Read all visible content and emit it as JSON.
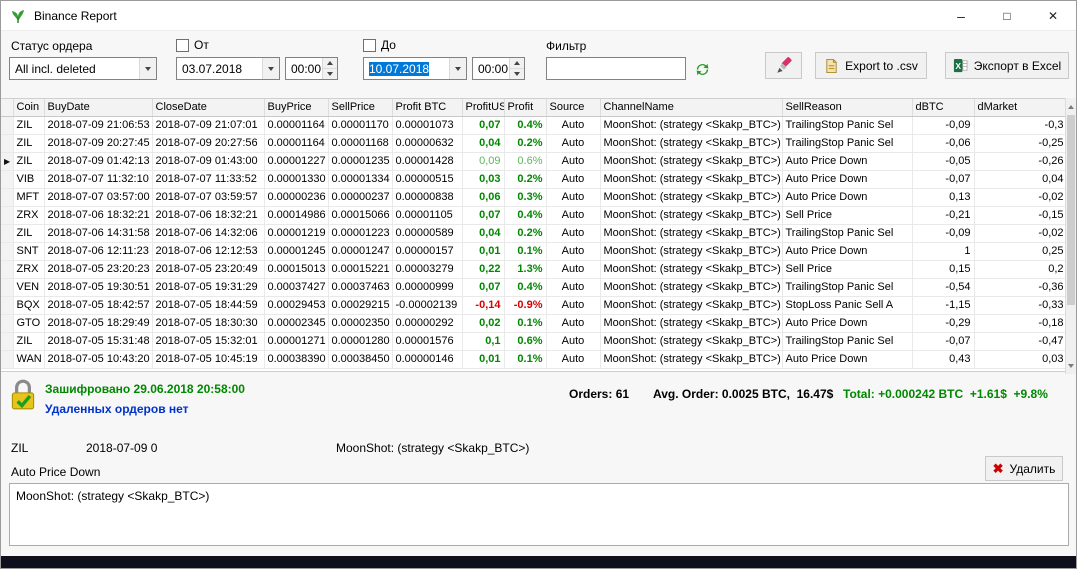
{
  "icons": {
    "row_marker": "▶",
    "delete_x": "✖"
  },
  "window": {
    "title": "Binance Report",
    "minimize": "–",
    "maximize": "□",
    "close": "✕"
  },
  "toolbar": {
    "order_status_label": "Статус ордера",
    "order_status_value": "All incl. deleted",
    "from_checkbox_label": "От",
    "from_date": "03.07.2018",
    "from_time": "00:00",
    "to_checkbox_label": "До",
    "to_date": "10.07.2018",
    "to_time": "00:00",
    "filter_label": "Фильтр",
    "filter_value": "",
    "export_csv_label": "Export to .csv",
    "export_excel_label": "Экспорт в Excel"
  },
  "grid": {
    "columns": [
      "Coin",
      "BuyDate",
      "CloseDate",
      "BuyPrice",
      "SellPrice",
      "Profit BTC",
      "ProfitUSD",
      "Profit",
      "Source",
      "ChannelName",
      "SellReason",
      "dBTC",
      "dMarket"
    ],
    "rows": [
      {
        "coin": "ZIL",
        "buy_date": "2018-07-09 21:06:53",
        "close_date": "2018-07-09 21:07:01",
        "buy_price": "0.00001164",
        "sell_price": "0.00001170",
        "profit_btc": "0.00001073",
        "profit_usd": "0,07",
        "profit_pct": "0.4%",
        "source": "Auto",
        "channel": "MoonShot: (strategy <Skakp_BTC>)",
        "sell_reason": "TrailingStop Panic Sel",
        "d_btc": "-0,09",
        "d_market": "-0,3",
        "selected": false
      },
      {
        "coin": "ZIL",
        "buy_date": "2018-07-09 20:27:45",
        "close_date": "2018-07-09 20:27:56",
        "buy_price": "0.00001164",
        "sell_price": "0.00001168",
        "profit_btc": "0.00000632",
        "profit_usd": "0,04",
        "profit_pct": "0.2%",
        "source": "Auto",
        "channel": "MoonShot: (strategy <Skakp_BTC>)",
        "sell_reason": "TrailingStop Panic Sel",
        "d_btc": "-0,06",
        "d_market": "-0,25",
        "selected": false
      },
      {
        "coin": "ZIL",
        "buy_date": "2018-07-09 01:42:13",
        "close_date": "2018-07-09 01:43:00",
        "buy_price": "0.00001227",
        "sell_price": "0.00001235",
        "profit_btc": "0.00001428",
        "profit_usd": "0,09",
        "profit_pct": "0.6%",
        "source": "Auto",
        "channel": "MoonShot: (strategy <Skakp_BTC>)",
        "sell_reason": "Auto Price Down",
        "d_btc": "-0,05",
        "d_market": "-0,26",
        "selected": true
      },
      {
        "coin": "VIB",
        "buy_date": "2018-07-07 11:32:10",
        "close_date": "2018-07-07 11:33:52",
        "buy_price": "0.00001330",
        "sell_price": "0.00001334",
        "profit_btc": "0.00000515",
        "profit_usd": "0,03",
        "profit_pct": "0.2%",
        "source": "Auto",
        "channel": "MoonShot: (strategy <Skakp_BTC>)",
        "sell_reason": "Auto Price Down",
        "d_btc": "-0,07",
        "d_market": "0,04",
        "selected": false
      },
      {
        "coin": "MFT",
        "buy_date": "2018-07-07 03:57:00",
        "close_date": "2018-07-07 03:59:57",
        "buy_price": "0.00000236",
        "sell_price": "0.00000237",
        "profit_btc": "0.00000838",
        "profit_usd": "0,06",
        "profit_pct": "0.3%",
        "source": "Auto",
        "channel": "MoonShot: (strategy <Skakp_BTC>)",
        "sell_reason": "Auto Price Down",
        "d_btc": "0,13",
        "d_market": "-0,02",
        "selected": false
      },
      {
        "coin": "ZRX",
        "buy_date": "2018-07-06 18:32:21",
        "close_date": "2018-07-06 18:32:21",
        "buy_price": "0.00014986",
        "sell_price": "0.00015066",
        "profit_btc": "0.00001105",
        "profit_usd": "0,07",
        "profit_pct": "0.4%",
        "source": "Auto",
        "channel": "MoonShot: (strategy <Skakp_BTC>)",
        "sell_reason": "Sell Price",
        "d_btc": "-0,21",
        "d_market": "-0,15",
        "selected": false
      },
      {
        "coin": "ZIL",
        "buy_date": "2018-07-06 14:31:58",
        "close_date": "2018-07-06 14:32:06",
        "buy_price": "0.00001219",
        "sell_price": "0.00001223",
        "profit_btc": "0.00000589",
        "profit_usd": "0,04",
        "profit_pct": "0.2%",
        "source": "Auto",
        "channel": "MoonShot: (strategy <Skakp_BTC>)",
        "sell_reason": "TrailingStop Panic Sel",
        "d_btc": "-0,09",
        "d_market": "-0,02",
        "selected": false
      },
      {
        "coin": "SNT",
        "buy_date": "2018-07-06 12:11:23",
        "close_date": "2018-07-06 12:12:53",
        "buy_price": "0.00001245",
        "sell_price": "0.00001247",
        "profit_btc": "0.00000157",
        "profit_usd": "0,01",
        "profit_pct": "0.1%",
        "source": "Auto",
        "channel": "MoonShot: (strategy <Skakp_BTC>)",
        "sell_reason": "Auto Price Down",
        "d_btc": "1",
        "d_market": "0,25",
        "selected": false
      },
      {
        "coin": "ZRX",
        "buy_date": "2018-07-05 23:20:23",
        "close_date": "2018-07-05 23:20:49",
        "buy_price": "0.00015013",
        "sell_price": "0.00015221",
        "profit_btc": "0.00003279",
        "profit_usd": "0,22",
        "profit_pct": "1.3%",
        "source": "Auto",
        "channel": "MoonShot: (strategy <Skakp_BTC>)",
        "sell_reason": "Sell Price",
        "d_btc": "0,15",
        "d_market": "0,2",
        "selected": false
      },
      {
        "coin": "VEN",
        "buy_date": "2018-07-05 19:30:51",
        "close_date": "2018-07-05 19:31:29",
        "buy_price": "0.00037427",
        "sell_price": "0.00037463",
        "profit_btc": "0.00000999",
        "profit_usd": "0,07",
        "profit_pct": "0.4%",
        "source": "Auto",
        "channel": "MoonShot: (strategy <Skakp_BTC>)",
        "sell_reason": "TrailingStop Panic Sel",
        "d_btc": "-0,54",
        "d_market": "-0,36",
        "selected": false
      },
      {
        "coin": "BQX",
        "buy_date": "2018-07-05 18:42:57",
        "close_date": "2018-07-05 18:44:59",
        "buy_price": "0.00029453",
        "sell_price": "0.00029215",
        "profit_btc": "-0.00002139",
        "profit_usd": "-0,14",
        "profit_pct": "-0.9%",
        "source": "Auto",
        "channel": "MoonShot: (strategy <Skakp_BTC>)",
        "sell_reason": "StopLoss Panic Sell A",
        "d_btc": "-1,15",
        "d_market": "-0,33",
        "selected": false
      },
      {
        "coin": "GTO",
        "buy_date": "2018-07-05 18:29:49",
        "close_date": "2018-07-05 18:30:30",
        "buy_price": "0.00002345",
        "sell_price": "0.00002350",
        "profit_btc": "0.00000292",
        "profit_usd": "0,02",
        "profit_pct": "0.1%",
        "source": "Auto",
        "channel": "MoonShot: (strategy <Skakp_BTC>)",
        "sell_reason": "Auto Price Down",
        "d_btc": "-0,29",
        "d_market": "-0,18",
        "selected": false
      },
      {
        "coin": "ZIL",
        "buy_date": "2018-07-05 15:31:48",
        "close_date": "2018-07-05 15:32:01",
        "buy_price": "0.00001271",
        "sell_price": "0.00001280",
        "profit_btc": "0.00001576",
        "profit_usd": "0,1",
        "profit_pct": "0.6%",
        "source": "Auto",
        "channel": "MoonShot: (strategy <Skakp_BTC>)",
        "sell_reason": "TrailingStop Panic Sel",
        "d_btc": "-0,07",
        "d_market": "-0,47",
        "selected": false
      },
      {
        "coin": "WAN",
        "buy_date": "2018-07-05 10:43:20",
        "close_date": "2018-07-05 10:45:19",
        "buy_price": "0.00038390",
        "sell_price": "0.00038450",
        "profit_btc": "0.00000146",
        "profit_usd": "0,01",
        "profit_pct": "0.1%",
        "source": "Auto",
        "channel": "MoonShot: (strategy <Skakp_BTC>)",
        "sell_reason": "Auto Price Down",
        "d_btc": "0,43",
        "d_market": "0,03",
        "selected": false
      }
    ]
  },
  "summary": {
    "encrypted_text": "Зашифровано 29.06.2018 20:58:00",
    "deleted_orders_text": "Удаленных ордеров нет",
    "orders_label": "Orders:",
    "orders_value": " 61",
    "avg_label": "Avg. Order:",
    "avg_value": " 0.0025 BTC,  16.47$",
    "total_label": "Total:",
    "total_value": " +0.000242 BTC  +1.61$  +9.8%"
  },
  "detail": {
    "coin": "ZIL",
    "date": "2018-07-09 0",
    "channel": "MoonShot: (strategy <Skakp_BTC>)",
    "sell_reason": "Auto Price Down",
    "delete_button_label": "Удалить",
    "memo": "MoonShot: (strategy <Skakp_BTC>)"
  }
}
